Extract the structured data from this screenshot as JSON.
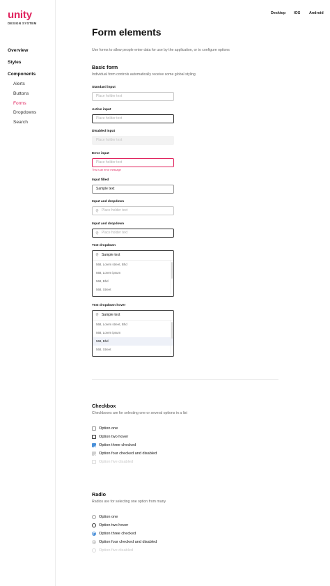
{
  "brand": {
    "name": "unity",
    "subtitle": "DESIGN SYSTEM",
    "accent": "#e0245e"
  },
  "topnav": [
    "Desktop",
    "IOS",
    "Android"
  ],
  "sidebar": {
    "overview": "Overview",
    "styles": "Styles",
    "components": "Components",
    "children": [
      "Alerts",
      "Buttons",
      "Forms",
      "Dropdowns",
      "Search"
    ],
    "active": "Forms"
  },
  "page": {
    "title": "Form elements",
    "description": "Use forms to allow people enter data for use by the application, or to configure options"
  },
  "basic_form": {
    "title": "Basic form",
    "description": "Individual form controls automatically receive some global styling",
    "standard": {
      "label": "Standard input",
      "placeholder": "Place holder text"
    },
    "active": {
      "label": "Active input",
      "placeholder": "Place holder text"
    },
    "disabled": {
      "label": "Disabled input",
      "placeholder": "Place holder text"
    },
    "error": {
      "label": "Error input",
      "placeholder": "Place holder text",
      "message": "This is an error message"
    },
    "filled": {
      "label": "Input filled",
      "value": "Sample text"
    },
    "dropdown1": {
      "label": "Input and dropdown",
      "placeholder": "Place holder text",
      "icon": "location-pin-icon"
    },
    "dropdown2": {
      "label": "Input and dropdown",
      "placeholder": "Place holder text",
      "icon": "location-pin-icon"
    },
    "text_dropdown": {
      "label": "Text dropdown",
      "value": "Sample text",
      "options": [
        "568, Lorem street, Bhd",
        "568, Lorem ipsum",
        "568, Bhd",
        "568, Street"
      ]
    },
    "text_dropdown_hover": {
      "label": "Text dropdown hover",
      "value": "Sample text",
      "options": [
        "568, Lorem street, Bhd",
        "568, Lorem ipsum",
        "568, Bhd",
        "568, Street"
      ],
      "hovered_index": 2
    }
  },
  "checkbox": {
    "title": "Checkbox",
    "description": "Checkboxes are for selecting one or several options in a list",
    "options": [
      {
        "label": "Option one",
        "state": "default"
      },
      {
        "label": "Option two hover",
        "state": "hover"
      },
      {
        "label": "Option three checked",
        "state": "checked"
      },
      {
        "label": "Option four checked and disabled",
        "state": "checked-disabled"
      },
      {
        "label": "Option five disabled",
        "state": "disabled"
      }
    ],
    "check_color": "#4a90d9"
  },
  "radio": {
    "title": "Radio",
    "description": "Radios are for selecting one option from many",
    "options": [
      {
        "label": "Option one",
        "state": "default"
      },
      {
        "label": "Option two hover",
        "state": "hover"
      },
      {
        "label": "Option three checked",
        "state": "checked"
      },
      {
        "label": "Option four checked and disabled",
        "state": "checked-disabled"
      },
      {
        "label": "Option five disabled",
        "state": "disabled"
      }
    ]
  }
}
